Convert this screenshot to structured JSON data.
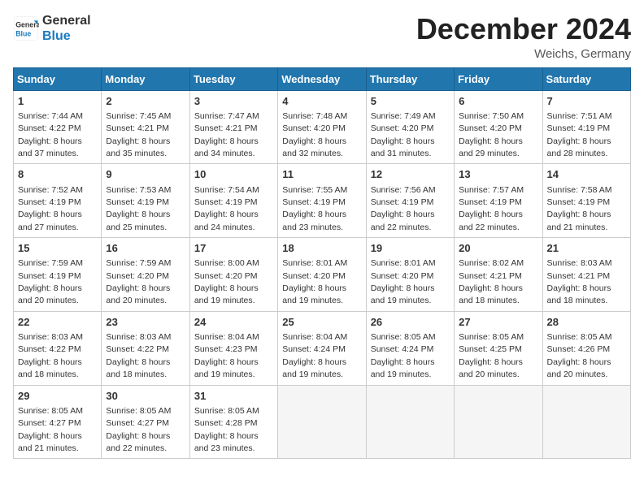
{
  "header": {
    "logo_line1": "General",
    "logo_line2": "Blue",
    "title": "December 2024",
    "subtitle": "Weichs, Germany"
  },
  "days_of_week": [
    "Sunday",
    "Monday",
    "Tuesday",
    "Wednesday",
    "Thursday",
    "Friday",
    "Saturday"
  ],
  "weeks": [
    [
      {
        "day": "1",
        "sunrise": "Sunrise: 7:44 AM",
        "sunset": "Sunset: 4:22 PM",
        "daylight": "Daylight: 8 hours and 37 minutes."
      },
      {
        "day": "2",
        "sunrise": "Sunrise: 7:45 AM",
        "sunset": "Sunset: 4:21 PM",
        "daylight": "Daylight: 8 hours and 35 minutes."
      },
      {
        "day": "3",
        "sunrise": "Sunrise: 7:47 AM",
        "sunset": "Sunset: 4:21 PM",
        "daylight": "Daylight: 8 hours and 34 minutes."
      },
      {
        "day": "4",
        "sunrise": "Sunrise: 7:48 AM",
        "sunset": "Sunset: 4:20 PM",
        "daylight": "Daylight: 8 hours and 32 minutes."
      },
      {
        "day": "5",
        "sunrise": "Sunrise: 7:49 AM",
        "sunset": "Sunset: 4:20 PM",
        "daylight": "Daylight: 8 hours and 31 minutes."
      },
      {
        "day": "6",
        "sunrise": "Sunrise: 7:50 AM",
        "sunset": "Sunset: 4:20 PM",
        "daylight": "Daylight: 8 hours and 29 minutes."
      },
      {
        "day": "7",
        "sunrise": "Sunrise: 7:51 AM",
        "sunset": "Sunset: 4:19 PM",
        "daylight": "Daylight: 8 hours and 28 minutes."
      }
    ],
    [
      {
        "day": "8",
        "sunrise": "Sunrise: 7:52 AM",
        "sunset": "Sunset: 4:19 PM",
        "daylight": "Daylight: 8 hours and 27 minutes."
      },
      {
        "day": "9",
        "sunrise": "Sunrise: 7:53 AM",
        "sunset": "Sunset: 4:19 PM",
        "daylight": "Daylight: 8 hours and 25 minutes."
      },
      {
        "day": "10",
        "sunrise": "Sunrise: 7:54 AM",
        "sunset": "Sunset: 4:19 PM",
        "daylight": "Daylight: 8 hours and 24 minutes."
      },
      {
        "day": "11",
        "sunrise": "Sunrise: 7:55 AM",
        "sunset": "Sunset: 4:19 PM",
        "daylight": "Daylight: 8 hours and 23 minutes."
      },
      {
        "day": "12",
        "sunrise": "Sunrise: 7:56 AM",
        "sunset": "Sunset: 4:19 PM",
        "daylight": "Daylight: 8 hours and 22 minutes."
      },
      {
        "day": "13",
        "sunrise": "Sunrise: 7:57 AM",
        "sunset": "Sunset: 4:19 PM",
        "daylight": "Daylight: 8 hours and 22 minutes."
      },
      {
        "day": "14",
        "sunrise": "Sunrise: 7:58 AM",
        "sunset": "Sunset: 4:19 PM",
        "daylight": "Daylight: 8 hours and 21 minutes."
      }
    ],
    [
      {
        "day": "15",
        "sunrise": "Sunrise: 7:59 AM",
        "sunset": "Sunset: 4:19 PM",
        "daylight": "Daylight: 8 hours and 20 minutes."
      },
      {
        "day": "16",
        "sunrise": "Sunrise: 7:59 AM",
        "sunset": "Sunset: 4:20 PM",
        "daylight": "Daylight: 8 hours and 20 minutes."
      },
      {
        "day": "17",
        "sunrise": "Sunrise: 8:00 AM",
        "sunset": "Sunset: 4:20 PM",
        "daylight": "Daylight: 8 hours and 19 minutes."
      },
      {
        "day": "18",
        "sunrise": "Sunrise: 8:01 AM",
        "sunset": "Sunset: 4:20 PM",
        "daylight": "Daylight: 8 hours and 19 minutes."
      },
      {
        "day": "19",
        "sunrise": "Sunrise: 8:01 AM",
        "sunset": "Sunset: 4:20 PM",
        "daylight": "Daylight: 8 hours and 19 minutes."
      },
      {
        "day": "20",
        "sunrise": "Sunrise: 8:02 AM",
        "sunset": "Sunset: 4:21 PM",
        "daylight": "Daylight: 8 hours and 18 minutes."
      },
      {
        "day": "21",
        "sunrise": "Sunrise: 8:03 AM",
        "sunset": "Sunset: 4:21 PM",
        "daylight": "Daylight: 8 hours and 18 minutes."
      }
    ],
    [
      {
        "day": "22",
        "sunrise": "Sunrise: 8:03 AM",
        "sunset": "Sunset: 4:22 PM",
        "daylight": "Daylight: 8 hours and 18 minutes."
      },
      {
        "day": "23",
        "sunrise": "Sunrise: 8:03 AM",
        "sunset": "Sunset: 4:22 PM",
        "daylight": "Daylight: 8 hours and 18 minutes."
      },
      {
        "day": "24",
        "sunrise": "Sunrise: 8:04 AM",
        "sunset": "Sunset: 4:23 PM",
        "daylight": "Daylight: 8 hours and 19 minutes."
      },
      {
        "day": "25",
        "sunrise": "Sunrise: 8:04 AM",
        "sunset": "Sunset: 4:24 PM",
        "daylight": "Daylight: 8 hours and 19 minutes."
      },
      {
        "day": "26",
        "sunrise": "Sunrise: 8:05 AM",
        "sunset": "Sunset: 4:24 PM",
        "daylight": "Daylight: 8 hours and 19 minutes."
      },
      {
        "day": "27",
        "sunrise": "Sunrise: 8:05 AM",
        "sunset": "Sunset: 4:25 PM",
        "daylight": "Daylight: 8 hours and 20 minutes."
      },
      {
        "day": "28",
        "sunrise": "Sunrise: 8:05 AM",
        "sunset": "Sunset: 4:26 PM",
        "daylight": "Daylight: 8 hours and 20 minutes."
      }
    ],
    [
      {
        "day": "29",
        "sunrise": "Sunrise: 8:05 AM",
        "sunset": "Sunset: 4:27 PM",
        "daylight": "Daylight: 8 hours and 21 minutes."
      },
      {
        "day": "30",
        "sunrise": "Sunrise: 8:05 AM",
        "sunset": "Sunset: 4:27 PM",
        "daylight": "Daylight: 8 hours and 22 minutes."
      },
      {
        "day": "31",
        "sunrise": "Sunrise: 8:05 AM",
        "sunset": "Sunset: 4:28 PM",
        "daylight": "Daylight: 8 hours and 23 minutes."
      },
      null,
      null,
      null,
      null
    ]
  ]
}
